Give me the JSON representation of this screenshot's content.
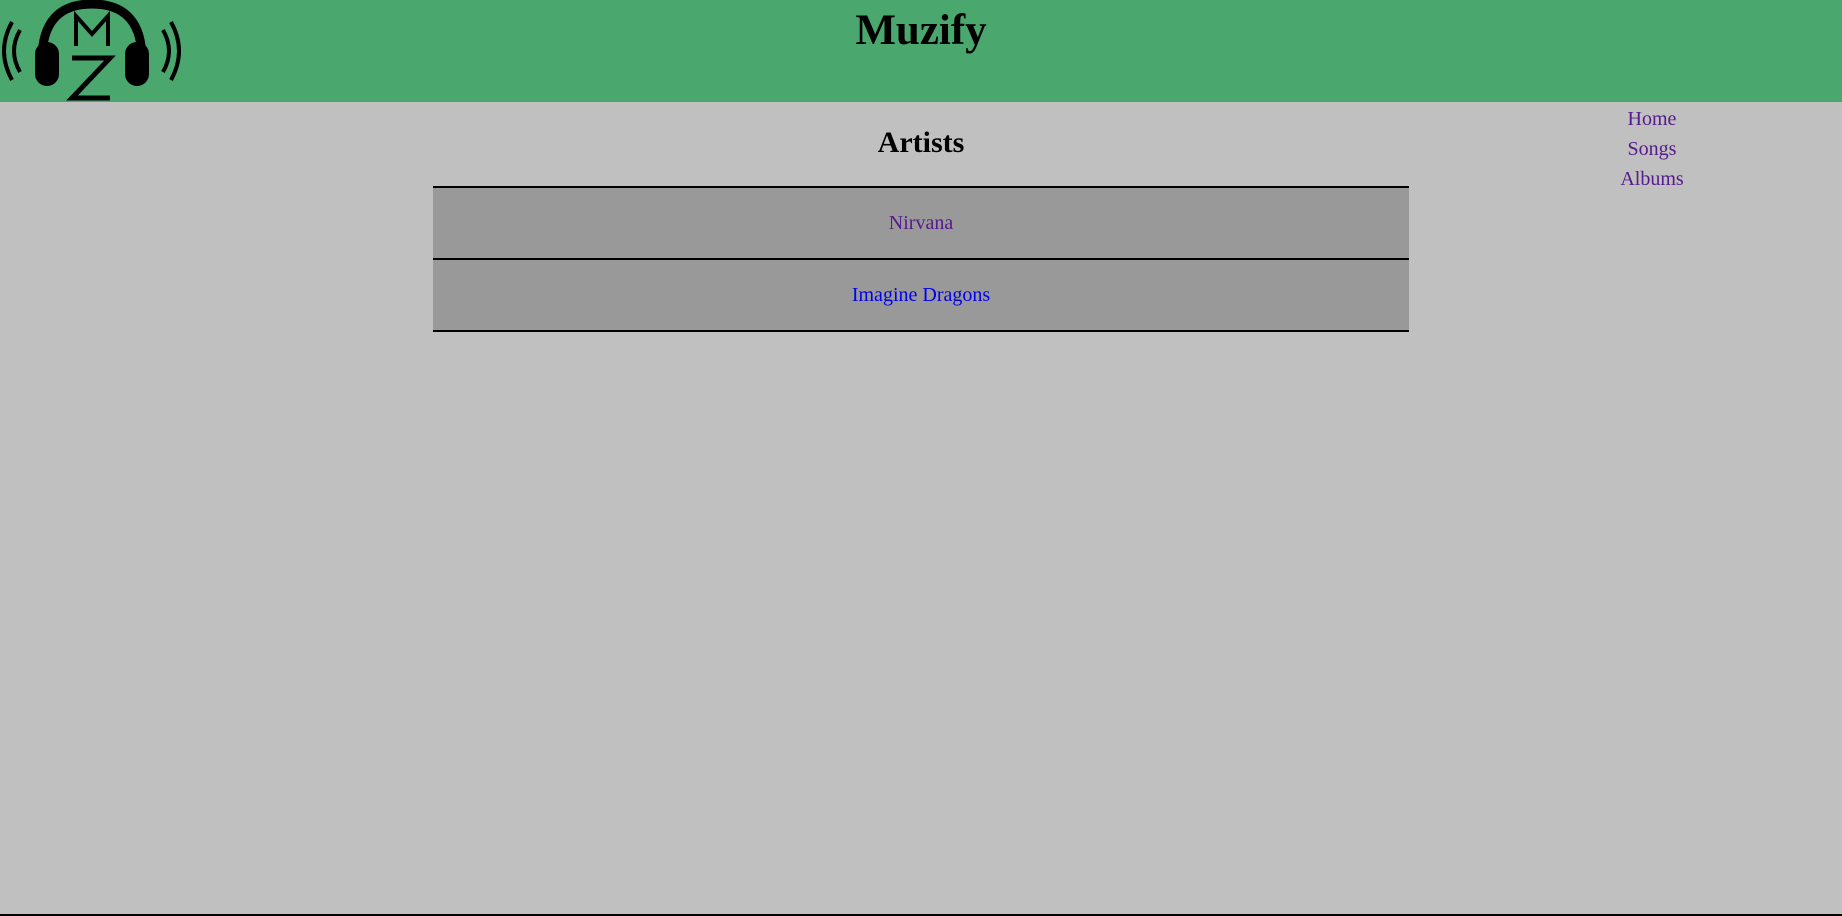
{
  "header": {
    "title": "Muzify",
    "logo_text": "MZ",
    "background_color": "#4aa76e"
  },
  "nav": {
    "items": [
      {
        "label": "Home",
        "color": "#551a8b"
      },
      {
        "label": "Songs",
        "color": "#551a8b"
      },
      {
        "label": "Albums",
        "color": "#551a8b"
      }
    ]
  },
  "main": {
    "heading": "Artists",
    "artists": [
      {
        "name": "Nirvana",
        "color": "#551a8b",
        "visited": true
      },
      {
        "name": "Imagine Dragons",
        "color": "#0000ee",
        "visited": false
      }
    ]
  }
}
